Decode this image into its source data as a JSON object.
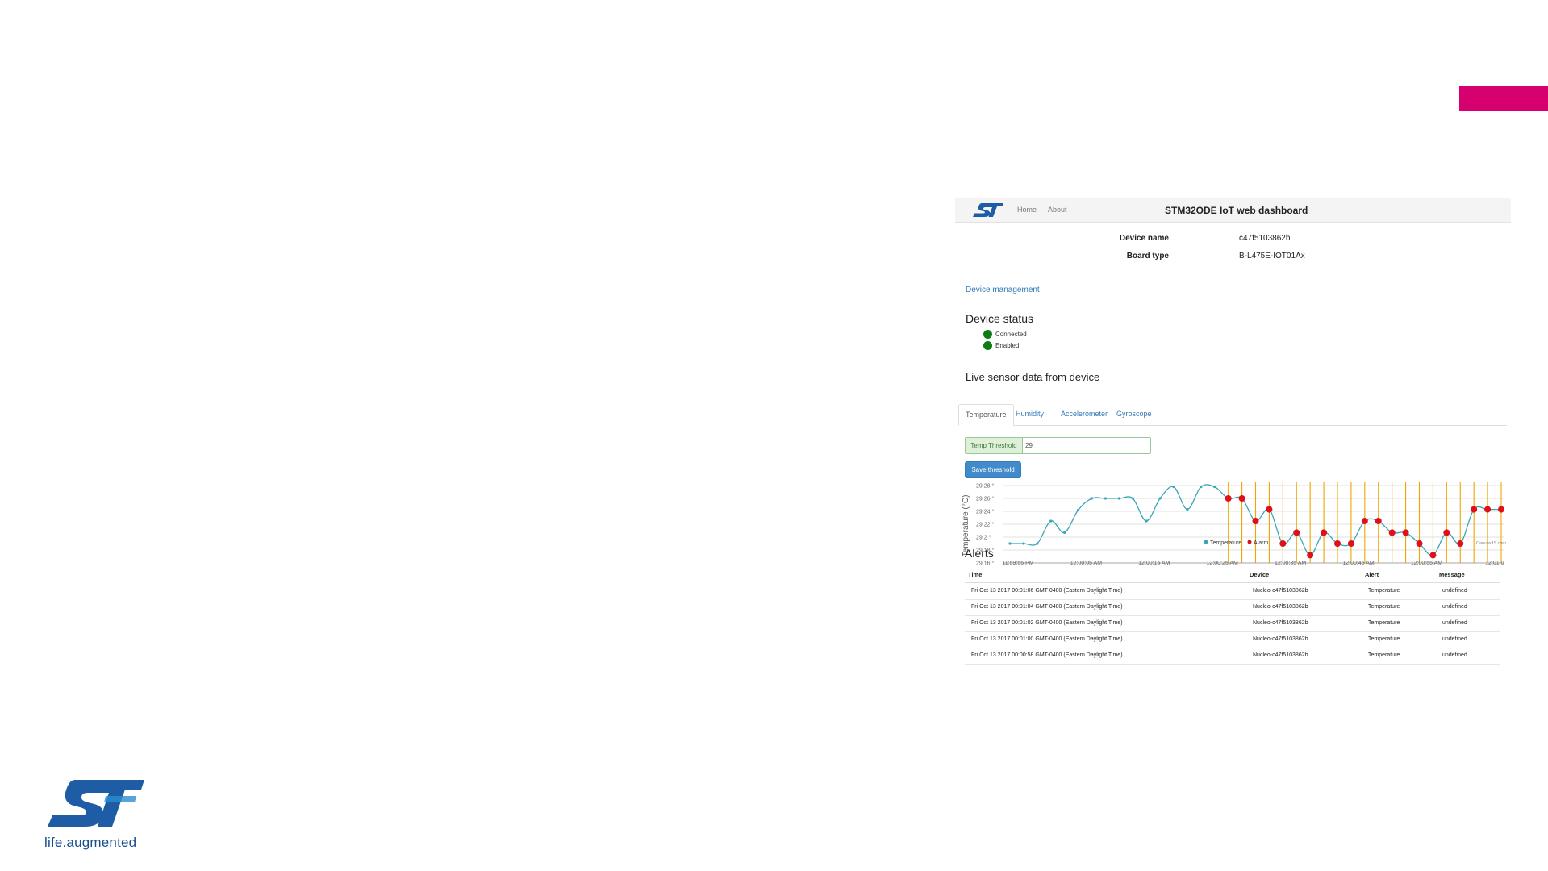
{
  "brand": {
    "tagline": "life.augmented"
  },
  "dashboard": {
    "nav": {
      "home": "Home",
      "about": "About",
      "title": "STM32ODE IoT web dashboard"
    },
    "device": {
      "name_label": "Device name",
      "name_value": "c47f5103862b",
      "board_label": "Board type",
      "board_value": "B-L475E-IOT01Ax"
    },
    "device_management": "Device management",
    "status": {
      "title": "Device status",
      "items": [
        "Connected",
        "Enabled"
      ],
      "color": "#0b7d12"
    },
    "live_title": "Live sensor data from device",
    "tabs": [
      "Temperature",
      "Humidity",
      "Accelerometer",
      "Gyroscope"
    ],
    "threshold": {
      "label": "Temp Threshold",
      "value": "29",
      "button": "Save threshold"
    },
    "alerts": {
      "title": "Alerts",
      "headers": [
        "Time",
        "Device",
        "Alert",
        "Message"
      ],
      "rows": [
        [
          "Fri Oct 13 2017 00:01:06 GMT-0400 (Eastern Daylight Time)",
          "Nucleo-c47f5103862b",
          "Temperature",
          "undefined"
        ],
        [
          "Fri Oct 13 2017 00:01:04 GMT-0400 (Eastern Daylight Time)",
          "Nucleo-c47f5103862b",
          "Temperature",
          "undefined"
        ],
        [
          "Fri Oct 13 2017 00:01:02 GMT-0400 (Eastern Daylight Time)",
          "Nucleo-c47f5103862b",
          "Temperature",
          "undefined"
        ],
        [
          "Fri Oct 13 2017 00:01:00 GMT-0400 (Eastern Daylight Time)",
          "Nucleo-c47f5103862b",
          "Temperature",
          "undefined"
        ],
        [
          "Fri Oct 13 2017 00:00:58 GMT-0400 (Eastern Daylight Time)",
          "Nucleo-c47f5103862b",
          "Temperature",
          "undefined"
        ]
      ]
    }
  },
  "colors": {
    "accent": "#d6006f",
    "temperature": "#3ba6b7",
    "alarm": "#e0101a",
    "alarm_line": "#f0a500",
    "link": "#3478b8",
    "button": "#428bca"
  },
  "chart_data": {
    "type": "line",
    "ylabel": "Temperature (°C)",
    "ylim": [
      29.16,
      29.28
    ],
    "y_ticks": [
      "29.16 °",
      "29.18 °",
      "29.2 °",
      "29.22 °",
      "29.24 °",
      "29.26 °",
      "29.28 °"
    ],
    "x_ticks": [
      "11:59:55 PM",
      "12:00:05 AM",
      "12:00:15 AM",
      "12:00:25 AM",
      "12:00:35 AM",
      "12:00:45 AM",
      "12:00:55 AM",
      "12:01:0"
    ],
    "watermark": "CanvasJS.com",
    "series": [
      {
        "name": "Temperature",
        "values": [
          29.19,
          29.19,
          29.19,
          29.225,
          29.207,
          29.242,
          29.26,
          29.26,
          29.26,
          29.26,
          29.225,
          29.26,
          29.278,
          29.243,
          29.278,
          29.278,
          29.26,
          29.26,
          29.225,
          29.243,
          29.19,
          29.207,
          29.172,
          29.207,
          29.19,
          29.19,
          29.225,
          29.225,
          29.207,
          29.207,
          29.19,
          29.172,
          29.207,
          29.19,
          29.243,
          29.243,
          29.243
        ]
      },
      {
        "name": "Alarm",
        "values": [
          null,
          null,
          null,
          null,
          null,
          null,
          null,
          null,
          null,
          null,
          null,
          null,
          null,
          null,
          null,
          null,
          29.26,
          29.26,
          29.225,
          29.243,
          29.19,
          29.207,
          29.172,
          29.207,
          29.19,
          29.19,
          29.225,
          29.225,
          29.207,
          29.207,
          29.19,
          29.172,
          29.207,
          29.19,
          29.243,
          29.243,
          29.243
        ]
      }
    ],
    "legend": "bottom-center"
  }
}
